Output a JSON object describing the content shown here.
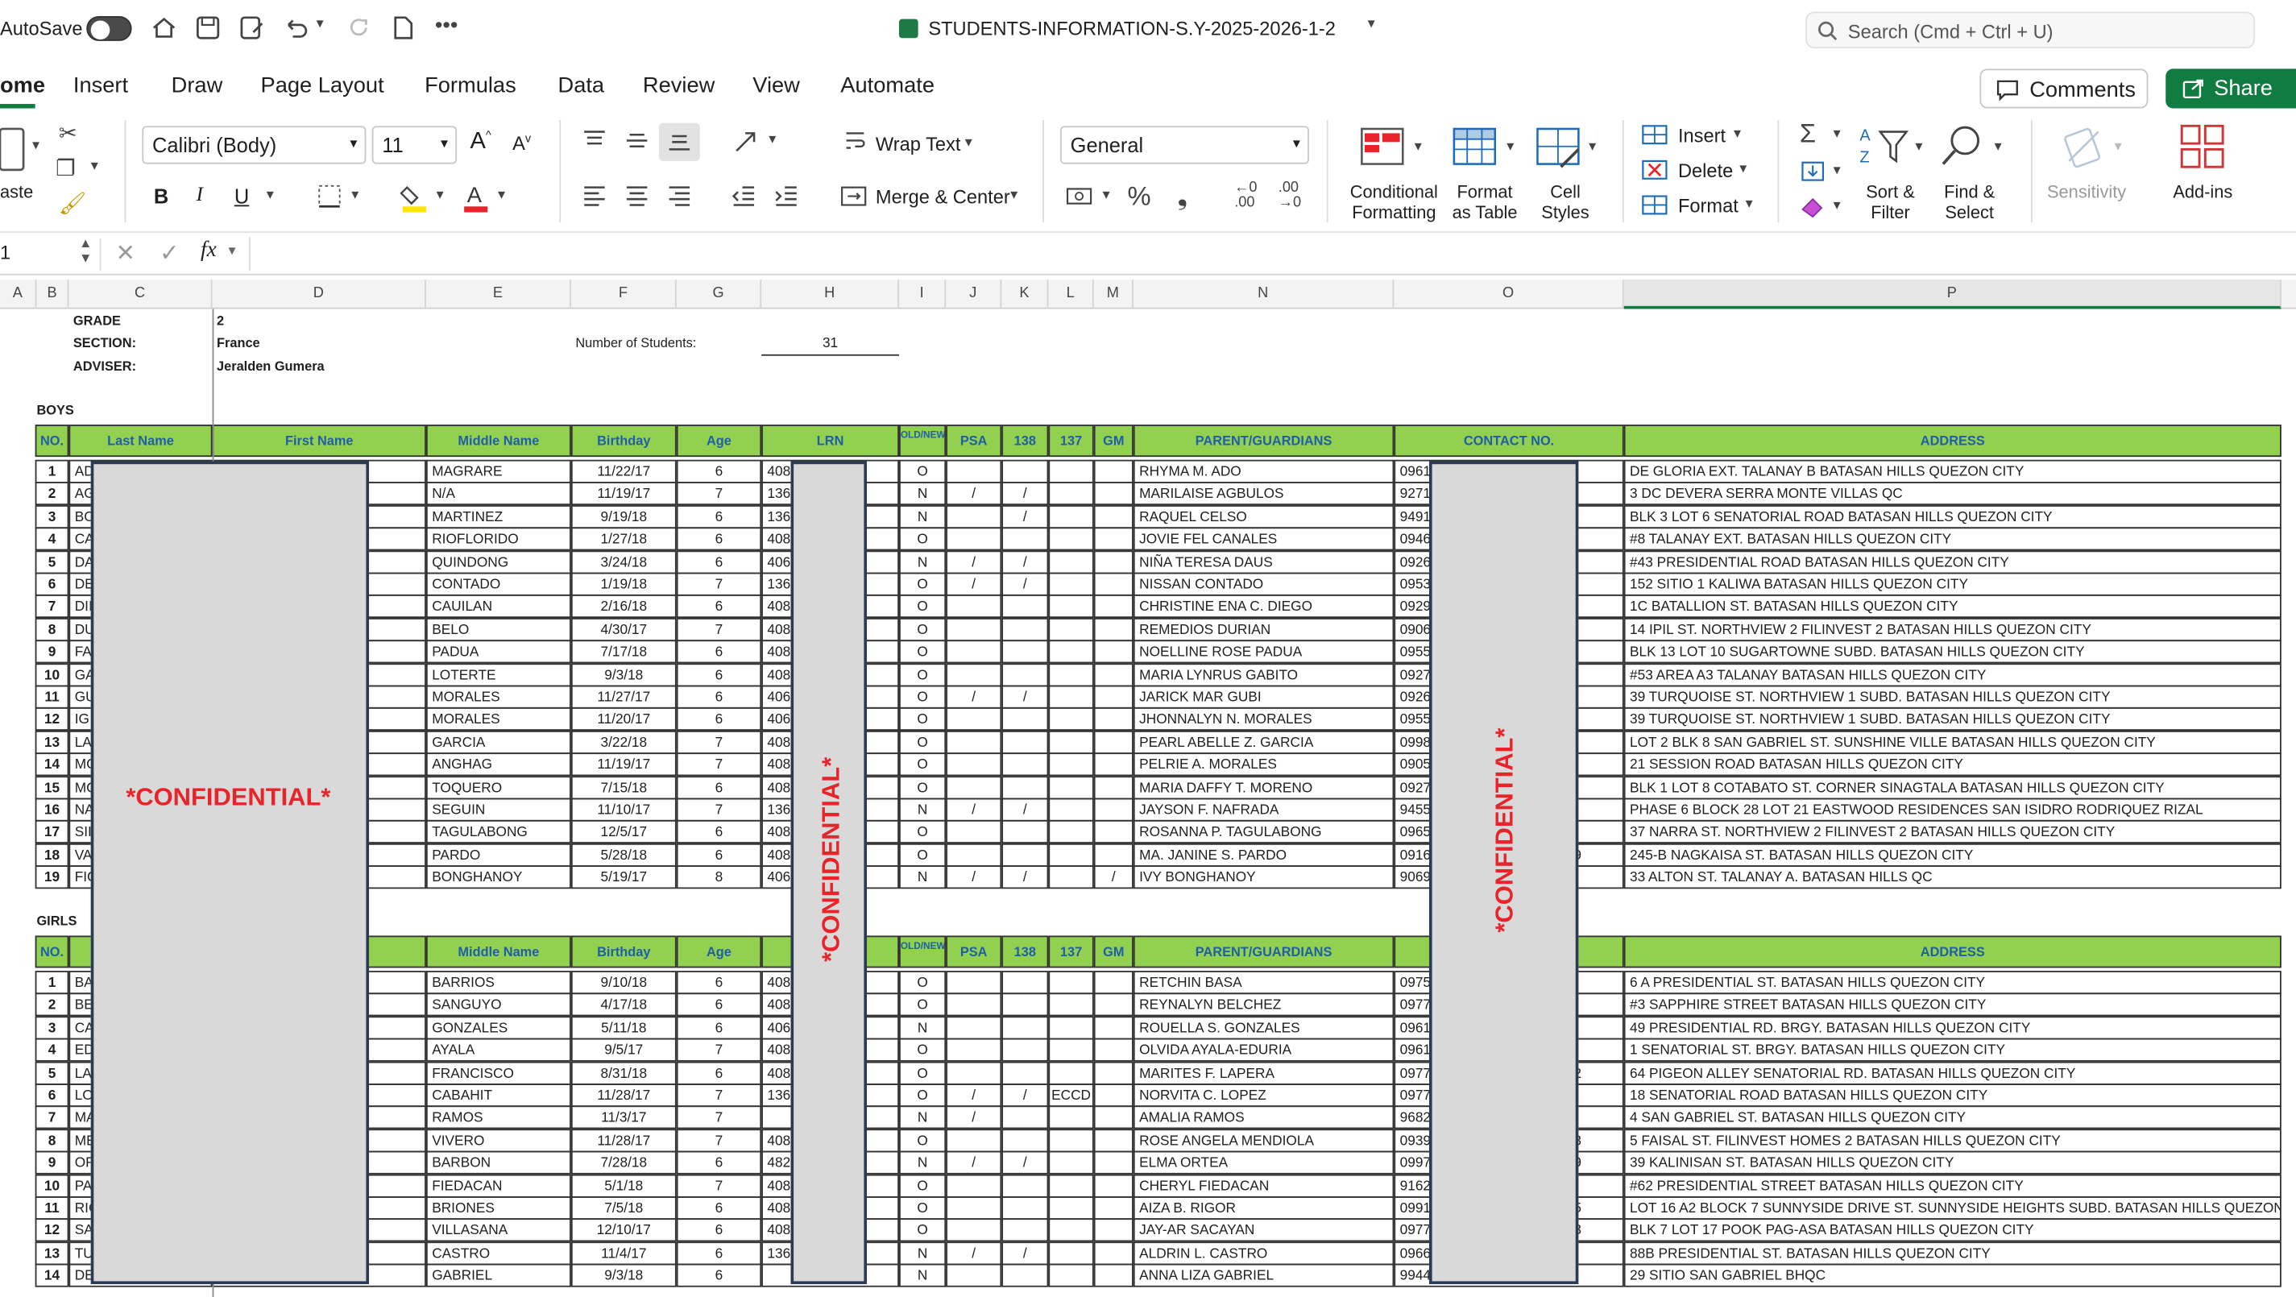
{
  "titlebar": {
    "autosave_label": "AutoSave",
    "file_name": "STUDENTS-INFORMATION-S.Y-2025-2026-1-2",
    "search_placeholder": "Search (Cmd + Ctrl + U)"
  },
  "ribbon_tabs": [
    "ome",
    "Insert",
    "Draw",
    "Page Layout",
    "Formulas",
    "Data",
    "Review",
    "View",
    "Automate"
  ],
  "comments_label": "Comments",
  "share_label": "Share",
  "ribbon": {
    "paste_label": "aste",
    "font_name": "Calibri (Body)",
    "font_size": "11",
    "wrap_text": "Wrap Text",
    "merge_center": "Merge & Center",
    "number_format": "General",
    "conditional_formatting": [
      "Conditional",
      "Formatting"
    ],
    "format_as_table": [
      "Format",
      "as Table"
    ],
    "cell_styles": [
      "Cell",
      "Styles"
    ],
    "insert": "Insert",
    "delete": "Delete",
    "format": "Format",
    "sort_filter": [
      "Sort &",
      "Filter"
    ],
    "find_select": [
      "Find &",
      "Select"
    ],
    "sensitivity": "Sensitivity",
    "addins": "Add-ins"
  },
  "formula_bar": {
    "name_box": "1",
    "fx": "fx"
  },
  "columns": [
    "A",
    "B",
    "C",
    "D",
    "E",
    "F",
    "G",
    "H",
    "I",
    "J",
    "K",
    "L",
    "M",
    "N",
    "O",
    "P"
  ],
  "info": {
    "grade_label": "GRADE",
    "grade": "2",
    "section_label": "SECTION:",
    "section": "France",
    "adviser_label": "ADVISER:",
    "adviser": "Jeralden Gumera",
    "num_students_label": "Number of Students:",
    "num_students": "31"
  },
  "boys_label": "BOYS",
  "girls_label": "GIRLS",
  "headers": {
    "no": "NO.",
    "last": "Last Name",
    "first": "First Name",
    "middle": "Middle Name",
    "birthday": "Birthday",
    "age": "Age",
    "lrn": "LRN",
    "oldnew": "OLD/NEW",
    "psa": "PSA",
    "c138": "138",
    "c137": "137",
    "gm": "GM",
    "parent": "PARENT/GUARDIANS",
    "contact": "CONTACT NO.",
    "address": "ADDRESS"
  },
  "confidential": "*CONFIDENTIAL*",
  "boys": [
    {
      "no": "1",
      "ln": "AD",
      "mid": "MAGRARE",
      "bd": "11/22/17",
      "age": "6",
      "lrn": "408",
      "on": "O",
      "psa": "",
      "c138": "",
      "c137": "",
      "gm": "",
      "par": "RHYMA M. ADO",
      "con": "0961",
      "con2": "",
      "addr": "DE GLORIA EXT. TALANAY B BATASAN HILLS QUEZON CITY"
    },
    {
      "no": "2",
      "ln": "AG",
      "mid": "N/A",
      "bd": "11/19/17",
      "age": "7",
      "lrn": "136",
      "on": "N",
      "psa": "/",
      "c138": "/",
      "c137": "",
      "gm": "",
      "par": "MARILAISE AGBULOS",
      "con": "9271",
      "con2": "",
      "addr": "3 DC DEVERA SERRA MONTE VILLAS  QC"
    },
    {
      "no": "3",
      "ln": "BO",
      "mid": "MARTINEZ",
      "bd": "9/19/18",
      "age": "6",
      "lrn": "136",
      "on": "N",
      "psa": "",
      "c138": "/",
      "c137": "",
      "gm": "",
      "par": "RAQUEL CELSO",
      "con": "9491",
      "con2": "",
      "addr": "BLK 3 LOT 6 SENATORIAL ROAD BATASAN HILLS QUEZON CITY"
    },
    {
      "no": "4",
      "ln": "CA",
      "mid": "RIOFLORIDO",
      "bd": "1/27/18",
      "age": "6",
      "lrn": "408",
      "on": "O",
      "psa": "",
      "c138": "",
      "c137": "",
      "gm": "",
      "par": "JOVIE FEL CANALES",
      "con": "0946",
      "con2": "",
      "addr": "#8 TALANAY EXT. BATASAN HILLS QUEZON CITY"
    },
    {
      "no": "5",
      "ln": "DA",
      "mid": "QUINDONG",
      "bd": "3/24/18",
      "age": "6",
      "lrn": "406",
      "on": "N",
      "psa": "/",
      "c138": "/",
      "c137": "",
      "gm": "",
      "par": "NIÑA TERESA DAUS",
      "con": "0926",
      "con2": "",
      "addr": "#43 PRESIDENTIAL ROAD BATASAN HILLS QUEZON CITY"
    },
    {
      "no": "6",
      "ln": "DE",
      "mid": "CONTADO",
      "bd": "1/19/18",
      "age": "7",
      "lrn": "136",
      "on": "O",
      "psa": "/",
      "c138": "/",
      "c137": "",
      "gm": "",
      "par": "NISSAN CONTADO",
      "con": "0953",
      "con2": "",
      "addr": "152 SITIO 1 KALIWA BATASAN HILLS QUEZON CITY"
    },
    {
      "no": "7",
      "ln": "DII",
      "mid": "CAUILAN",
      "bd": "2/16/18",
      "age": "6",
      "lrn": "408",
      "on": "O",
      "psa": "",
      "c138": "",
      "c137": "",
      "gm": "",
      "par": "CHRISTINE ENA C. DIEGO",
      "con": "0929",
      "con2": "",
      "addr": "1C BATALLION ST. BATASAN HILLS QUEZON CITY"
    },
    {
      "no": "8",
      "ln": "DU",
      "mid": "BELO",
      "bd": "4/30/17",
      "age": "7",
      "lrn": "408",
      "on": "O",
      "psa": "",
      "c138": "",
      "c137": "",
      "gm": "",
      "par": "REMEDIOS DURIAN",
      "con": "0906",
      "con2": "",
      "addr": "14 IPIL ST. NORTHVIEW 2 FILINVEST 2 BATASAN HILLS QUEZON CITY"
    },
    {
      "no": "9",
      "ln": "FA",
      "mid": "PADUA",
      "bd": "7/17/18",
      "age": "6",
      "lrn": "408",
      "on": "O",
      "psa": "",
      "c138": "",
      "c137": "",
      "gm": "",
      "par": "NOELLINE ROSE PADUA",
      "con": "0955",
      "con2": "",
      "addr": "BLK 13 LOT 10 SUGARTOWNE SUBD. BATASAN HILLS QUEZON CITY"
    },
    {
      "no": "10",
      "ln": "GA",
      "mid": "LOTERTE",
      "bd": "9/3/18",
      "age": "6",
      "lrn": "408",
      "on": "O",
      "psa": "",
      "c138": "",
      "c137": "",
      "gm": "",
      "par": "MARIA LYNRUS GABITO",
      "con": "0927",
      "con2": "",
      "addr": "#53 AREA A3 TALANAY BATASAN HILLS QUEZON CITY"
    },
    {
      "no": "11",
      "ln": "GU",
      "mid": "MORALES",
      "bd": "11/27/17",
      "age": "6",
      "lrn": "406",
      "on": "O",
      "psa": "/",
      "c138": "/",
      "c137": "",
      "gm": "",
      "par": "JARICK MAR GUBI",
      "con": "0926",
      "con2": "",
      "addr": "39 TURQUOISE ST. NORTHVIEW 1 SUBD. BATASAN HILLS QUEZON CITY"
    },
    {
      "no": "12",
      "ln": "IG",
      "mid": "MORALES",
      "bd": "11/20/17",
      "age": "6",
      "lrn": "406",
      "on": "O",
      "psa": "",
      "c138": "",
      "c137": "",
      "gm": "",
      "par": "JHONNALYN N. MORALES",
      "con": "0955",
      "con2": "",
      "addr": "39 TURQUOISE ST. NORTHVIEW 1 SUBD. BATASAN HILLS QUEZON CITY"
    },
    {
      "no": "13",
      "ln": "LA",
      "mid": "GARCIA",
      "bd": "3/22/18",
      "age": "7",
      "lrn": "408",
      "on": "O",
      "psa": "",
      "c138": "",
      "c137": "",
      "gm": "",
      "par": "PEARL ABELLE Z. GARCIA",
      "con": "0998",
      "con2": "",
      "addr": "LOT 2 BLK 8 SAN GABRIEL ST. SUNSHINE VILLE BATASAN HILLS QUEZON CITY"
    },
    {
      "no": "14",
      "ln": "MC",
      "mid": "ANGHAG",
      "bd": "11/19/17",
      "age": "7",
      "lrn": "408",
      "on": "O",
      "psa": "",
      "c138": "",
      "c137": "",
      "gm": "",
      "par": "PELRIE A. MORALES",
      "con": "0905",
      "con2": "",
      "addr": "21 SESSION ROAD BATASAN HILLS QUEZON CITY"
    },
    {
      "no": "15",
      "ln": "MC",
      "mid": "TOQUERO",
      "bd": "7/15/18",
      "age": "6",
      "lrn": "408",
      "on": "O",
      "psa": "",
      "c138": "",
      "c137": "",
      "gm": "",
      "par": "MARIA DAFFY T. MORENO",
      "con": "0927",
      "con2": "",
      "addr": "BLK 1 LOT 8 COTABATO ST. CORNER SINAGTALA BATASAN HILLS QUEZON CITY"
    },
    {
      "no": "16",
      "ln": "NA",
      "mid": "SEGUIN",
      "bd": "11/10/17",
      "age": "7",
      "lrn": "136",
      "on": "N",
      "psa": "/",
      "c138": "/",
      "c137": "",
      "gm": "",
      "par": "JAYSON F. NAFRADA",
      "con": "9455",
      "con2": "",
      "addr": "PHASE 6 BLOCK 28 LOT 21 EASTWOOD RESIDENCES SAN ISIDRO RODRIQUEZ RIZAL"
    },
    {
      "no": "17",
      "ln": "SII",
      "mid": "TAGULABONG",
      "bd": "12/5/17",
      "age": "6",
      "lrn": "408",
      "on": "O",
      "psa": "",
      "c138": "",
      "c137": "",
      "gm": "",
      "par": "ROSANNA P. TAGULABONG",
      "con": "0965",
      "con2": "",
      "addr": "37 NARRA ST. NORTHVIEW 2 FILINVEST 2 BATASAN HILLS QUEZON CITY"
    },
    {
      "no": "18",
      "ln": "VA",
      "mid": "PARDO",
      "bd": "5/28/18",
      "age": "6",
      "lrn": "408",
      "on": "O",
      "psa": "",
      "c138": "",
      "c137": "",
      "gm": "",
      "par": "MA. JANINE S. PARDO",
      "con": "0916",
      "con2": "9",
      "addr": "245-B NAGKAISA ST. BATASAN HILLS QUEZON CITY"
    },
    {
      "no": "19",
      "ln": "FIC",
      "mid": "BONGHANOY",
      "bd": "5/19/17",
      "age": "8",
      "lrn": "406",
      "on": "N",
      "psa": "/",
      "c138": "/",
      "c137": "",
      "gm": "/",
      "par": "IVY BONGHANOY",
      "con": "9069",
      "con2": "",
      "addr": "33 ALTON ST. TALANAY A. BATASAN HILLS QC"
    }
  ],
  "girls": [
    {
      "no": "1",
      "ln": "BA",
      "mid": "BARRIOS",
      "bd": "9/10/18",
      "age": "6",
      "lrn": "408",
      "on": "O",
      "psa": "",
      "c138": "",
      "c137": "",
      "gm": "",
      "par": "RETCHIN BASA",
      "con": "0975",
      "con2": "",
      "addr": "6 A PRESIDENTIAL ST. BATASAN HILLS QUEZON CITY"
    },
    {
      "no": "2",
      "ln": "BE",
      "mid": "SANGUYO",
      "bd": "4/17/18",
      "age": "6",
      "lrn": "408",
      "on": "O",
      "psa": "",
      "c138": "",
      "c137": "",
      "gm": "",
      "par": "REYNALYN BELCHEZ",
      "con": "0977",
      "con2": "",
      "addr": "#3 SAPPHIRE STREET BATASAN HILLS QUEZON CITY"
    },
    {
      "no": "3",
      "ln": "CA",
      "mid": "GONZALES",
      "bd": "5/11/18",
      "age": "6",
      "lrn": "406",
      "on": "N",
      "psa": "",
      "c138": "",
      "c137": "",
      "gm": "",
      "par": "ROUELLA S. GONZALES",
      "con": "0961",
      "con2": "",
      "addr": "49 PRESIDENTIAL RD. BRGY. BATASAN HILLS QUEZON CITY"
    },
    {
      "no": "4",
      "ln": "ED",
      "mid": "AYALA",
      "bd": "9/5/17",
      "age": "7",
      "lrn": "408",
      "on": "O",
      "psa": "",
      "c138": "",
      "c137": "",
      "gm": "",
      "par": "OLVIDA AYALA-EDURIA",
      "con": "0961",
      "con2": "",
      "addr": "1 SENATORIAL ST. BRGY. BATASAN HILLS QUEZON CITY"
    },
    {
      "no": "5",
      "ln": "LA",
      "mid": "FRANCISCO",
      "bd": "8/31/18",
      "age": "6",
      "lrn": "408",
      "on": "O",
      "psa": "",
      "c138": "",
      "c137": "",
      "gm": "",
      "par": "MARITES F. LAPERA",
      "con": "0977",
      "con2": "2",
      "addr": "64 PIGEON ALLEY SENATORIAL RD. BATASAN HILLS QUEZON CITY"
    },
    {
      "no": "6",
      "ln": "LO",
      "mid": "CABAHIT",
      "bd": "11/28/17",
      "age": "7",
      "lrn": "136",
      "on": "O",
      "psa": "/",
      "c138": "/",
      "c137": "ECCD",
      "gm": "",
      "par": "NORVITA C. LOPEZ",
      "con": "0977",
      "con2": "",
      "addr": "18 SENATORIAL ROAD BATASAN HILLS QUEZON CITY"
    },
    {
      "no": "7",
      "ln": "MA",
      "mid": "RAMOS",
      "bd": "11/3/17",
      "age": "7",
      "lrn": "",
      "on": "N",
      "psa": "/",
      "c138": "",
      "c137": "",
      "gm": "",
      "par": "AMALIA RAMOS",
      "con": "9682",
      "con2": "",
      "addr": "4 SAN GABRIEL ST. BATASAN HILLS QUEZON CITY"
    },
    {
      "no": "8",
      "ln": "ME",
      "mid": "VIVERO",
      "bd": "11/28/17",
      "age": "7",
      "lrn": "408",
      "on": "O",
      "psa": "",
      "c138": "",
      "c137": "",
      "gm": "",
      "par": "ROSE ANGELA MENDIOLA",
      "con": "0939",
      "con2": "3",
      "addr": "5 FAISAL ST. FILINVEST HOMES 2 BATASAN HILLS QUEZON CITY"
    },
    {
      "no": "9",
      "ln": "OR",
      "mid": "BARBON",
      "bd": "7/28/18",
      "age": "6",
      "lrn": "482",
      "on": "N",
      "psa": "/",
      "c138": "/",
      "c137": "",
      "gm": "",
      "par": "ELMA ORTEA",
      "con": "0997",
      "con2": "9",
      "addr": "39 KALINISAN ST. BATASAN HILLS QUEZON CITY"
    },
    {
      "no": "10",
      "ln": "PA",
      "mid": "FIEDACAN",
      "bd": "5/1/18",
      "age": "7",
      "lrn": "408",
      "on": "O",
      "psa": "",
      "c138": "",
      "c137": "",
      "gm": "",
      "par": "CHERYL FIEDACAN",
      "con": "9162",
      "con2": "",
      "addr": "#62 PRESIDENTIAL STREET BATASAN HILLS QUEZON CITY"
    },
    {
      "no": "11",
      "ln": "RIC",
      "mid": "BRIONES",
      "bd": "7/5/18",
      "age": "6",
      "lrn": "408",
      "on": "O",
      "psa": "",
      "c138": "",
      "c137": "",
      "gm": "",
      "par": "AIZA B. RIGOR",
      "con": "0991",
      "con2": "5",
      "addr": "LOT 16 A2 BLOCK 7 SUNNYSIDE DRIVE ST. SUNNYSIDE HEIGHTS SUBD. BATASAN HILLS QUEZON CITY"
    },
    {
      "no": "12",
      "ln": "SA",
      "mid": "VILLASANA",
      "bd": "12/10/17",
      "age": "6",
      "lrn": "408",
      "on": "O",
      "psa": "",
      "c138": "",
      "c137": "",
      "gm": "",
      "par": "JAY-AR SACAYAN",
      "con": "0977",
      "con2": "3",
      "addr": "BLK 7 LOT 17 POOK PAG-ASA BATASAN HILLS QUEZON CITY"
    },
    {
      "no": "13",
      "ln": "TU",
      "mid": "CASTRO",
      "bd": "11/4/17",
      "age": "6",
      "lrn": "136",
      "on": "N",
      "psa": "/",
      "c138": "/",
      "c137": "",
      "gm": "",
      "par": "ALDRIN L. CASTRO",
      "con": "0966",
      "con2": "",
      "addr": "88B PRESIDENTIAL ST. BATASAN HILLS QUEZON CITY"
    },
    {
      "no": "14",
      "ln": "DE",
      "mid": "GABRIEL",
      "bd": "9/3/18",
      "age": "6",
      "lrn": "",
      "on": "N",
      "psa": "",
      "c138": "",
      "c137": "",
      "gm": "",
      "par": "ANNA LIZA GABRIEL",
      "con": "9944",
      "con2": "",
      "addr": "29 SITIO SAN GABRIEL BHQC"
    }
  ]
}
